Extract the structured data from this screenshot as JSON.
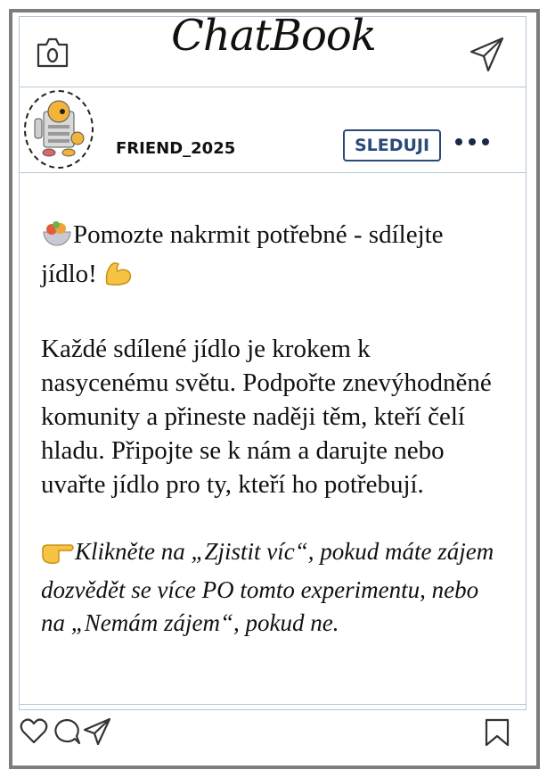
{
  "app": {
    "title": "ChatBook"
  },
  "header": {
    "camera_icon": "camera-icon",
    "send_icon": "paper-plane-icon"
  },
  "profile": {
    "username": "FRIEND_2025",
    "follow_label": "SLEDUJI",
    "more_icon": "more-dots-icon",
    "avatar_icon": "robot-avatar"
  },
  "post": {
    "headline": "Pomozte nakrmit potřebné - sdílejte jídlo!",
    "body": "Každé sdílené jídlo je krokem k nasycenému světu. Podpořte znevýhodněné komunity a přineste naději těm, kteří čelí hladu. Připojte se k nám a darujte nebo uvařte jídlo pro ty, kteří ho potřebují.",
    "cta": "Klikněte na „Zjistit víc“, pokud máte zájem dozvědět se více PO tomto experimentu, nebo na „Nemám zájem“, pokud ne.",
    "headline_emojis": [
      "food-bowl-emoji",
      "flexed-biceps-emoji"
    ],
    "cta_emoji": "pointing-right-emoji"
  },
  "actions": {
    "like_icon": "heart-icon",
    "comment_icon": "comment-icon",
    "share_icon": "paper-plane-icon",
    "save_icon": "bookmark-icon"
  },
  "colors": {
    "frame": "#7d7d7d",
    "divider": "#b9c7d6",
    "accent": "#2a4a7a"
  }
}
